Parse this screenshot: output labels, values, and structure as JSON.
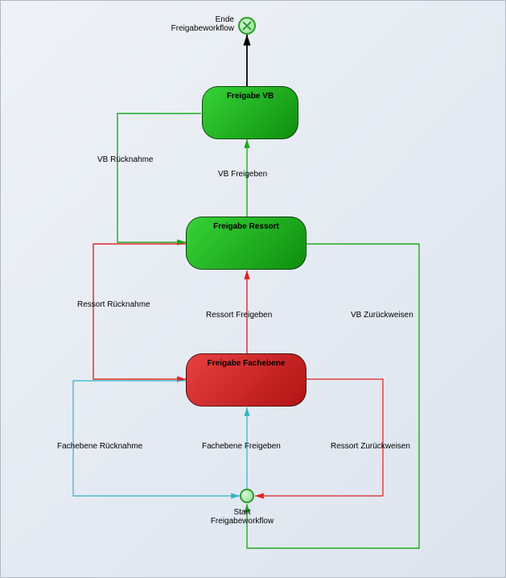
{
  "events": {
    "end": {
      "label": "Ende\nFreigabeworkflow"
    },
    "start": {
      "label": "Start\nFreigabeworkflow"
    }
  },
  "nodes": {
    "vb": {
      "title": "Freigabe VB"
    },
    "ressort": {
      "title": "Freigabe Ressort"
    },
    "fach": {
      "title": "Freigabe Fachebene"
    }
  },
  "edges": {
    "vb_ruecknahme": "VB Rücknahme",
    "vb_freigeben": "VB Freigeben",
    "ressort_ruecknahme": "Ressort Rücknahme",
    "ressort_freigeben": "Ressort Freigeben",
    "vb_zurueckweisen": "VB Zurückweisen",
    "fachebene_ruecknahme": "Fachebene Rücknahme",
    "fachebene_freigeben": "Fachebene Freigeben",
    "ressort_zurueckweisen": "Ressort Zurückweisen"
  },
  "chart_data": {
    "type": "diagram",
    "title": "Freigabeworkflow state diagram",
    "nodes": [
      {
        "id": "start",
        "type": "start-event",
        "label": "Start Freigabeworkflow"
      },
      {
        "id": "fach",
        "type": "state",
        "label": "Freigabe Fachebene",
        "color": "red"
      },
      {
        "id": "ressort",
        "type": "state",
        "label": "Freigabe Ressort",
        "color": "green"
      },
      {
        "id": "vb",
        "type": "state",
        "label": "Freigabe VB",
        "color": "green"
      },
      {
        "id": "end",
        "type": "end-event",
        "label": "Ende Freigabeworkflow"
      }
    ],
    "transitions": [
      {
        "from": "start",
        "to": "fach",
        "label": "Fachebene Freigeben",
        "color": "cyan"
      },
      {
        "from": "fach",
        "to": "ressort",
        "label": "Ressort Freigeben",
        "color": "red"
      },
      {
        "from": "ressort",
        "to": "vb",
        "label": "VB Freigeben",
        "color": "green"
      },
      {
        "from": "vb",
        "to": "end",
        "label": "",
        "color": "black"
      },
      {
        "from": "vb",
        "to": "ressort",
        "label": "VB Rücknahme",
        "color": "green"
      },
      {
        "from": "ressort",
        "to": "fach",
        "label": "Ressort Rücknahme",
        "color": "red"
      },
      {
        "from": "fach",
        "to": "start",
        "label": "Fachebene Rücknahme",
        "color": "cyan"
      },
      {
        "from": "vb",
        "to": "start",
        "label": "VB Zurückweisen",
        "color": "green"
      },
      {
        "from": "ressort",
        "to": "start",
        "label": "Ressort Zurückweisen",
        "color": "red"
      }
    ]
  }
}
